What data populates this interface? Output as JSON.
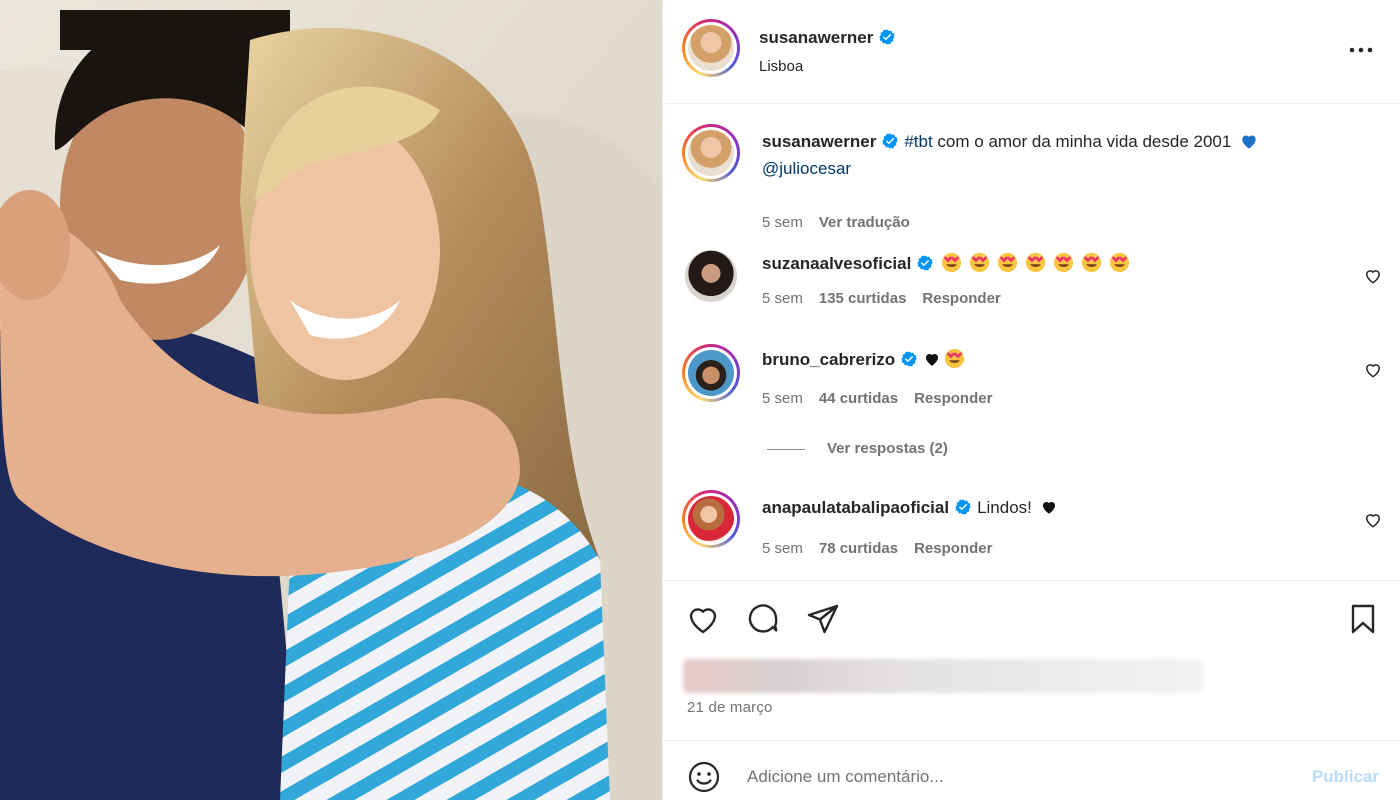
{
  "post": {
    "author": "susanawerner",
    "location": "Lisboa",
    "photo_description": "couple-photo",
    "caption": {
      "username": "susanawerner",
      "hashtag": "#tbt",
      "text": " com o amor da minha vida desde 2001",
      "mention": "@juliocesar",
      "time": "5 sem",
      "translate": "Ver tradução"
    },
    "date": "21 de março"
  },
  "comments": [
    {
      "username": "suzanaalvesoficial",
      "text": "",
      "emoji_count": 7,
      "time": "5 sem",
      "likes": "135 curtidas",
      "reply": "Responder"
    },
    {
      "username": "bruno_cabrerizo",
      "text": "",
      "time": "5 sem",
      "likes": "44 curtidas",
      "reply": "Responder"
    },
    {
      "username": "anapaulatabalipaoficial",
      "text": "Lindos!",
      "time": "5 sem",
      "likes": "78 curtidas",
      "reply": "Responder"
    }
  ],
  "view_replies": "Ver respostas (2)",
  "composer": {
    "placeholder": "Adicione um comentário...",
    "publish": "Publicar"
  },
  "colors": {
    "link": "#00376b",
    "muted": "#737373",
    "verified": "#0095f6",
    "publish_disabled": "#b9dcfb"
  },
  "icons": [
    "heart-icon",
    "comment-icon",
    "share-icon",
    "bookmark-icon",
    "more-icon",
    "verified-icon",
    "emoji-icon",
    "blue-heart-icon",
    "black-heart-icon",
    "heart-eyes-emoji"
  ]
}
